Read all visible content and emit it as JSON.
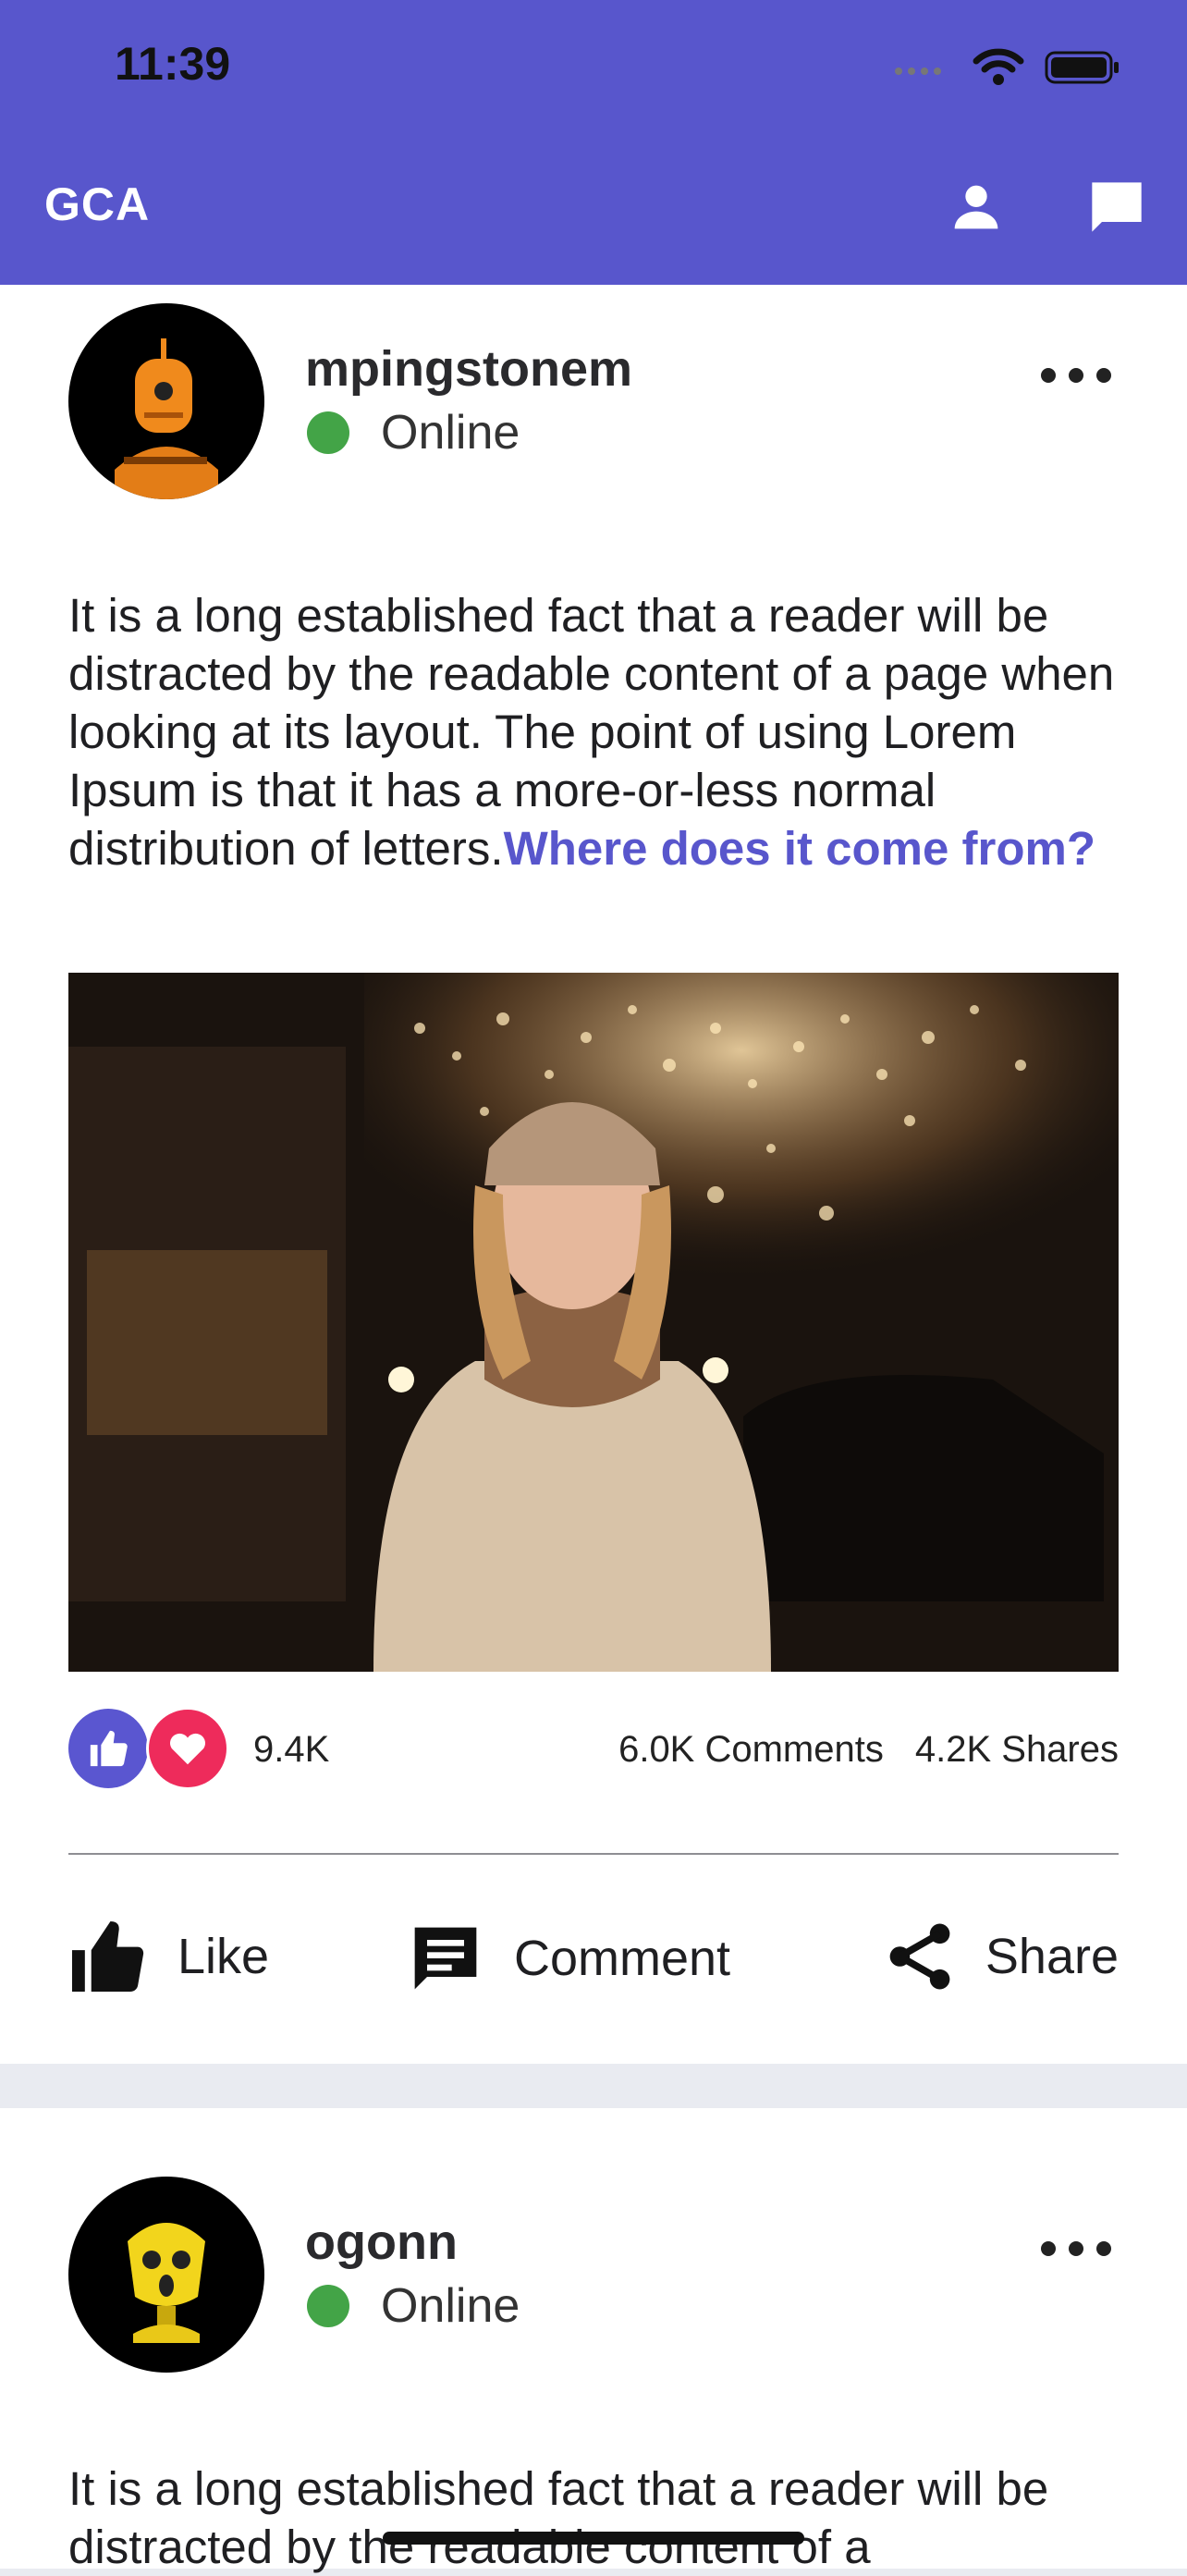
{
  "status_bar": {
    "time": "11:39"
  },
  "app_bar": {
    "title": "GCA",
    "icons": [
      "profile-icon",
      "chat-icon"
    ],
    "color": "#5856cc"
  },
  "posts": [
    {
      "username": "mpingstonem",
      "presence": "Online",
      "caption": "It is a long established fact that a reader will be distracted by the readable content of a page when looking at its layout. The point of using Lorem Ipsum is that it has a more-or-less normal distribution of letters.",
      "link": "Where does it come from?",
      "likes": "9.4K",
      "comments": "6.0K Comments",
      "shares": "4.2K Shares"
    },
    {
      "username": "ogonn",
      "presence": "Online",
      "caption": "It is a long established fact that a reader will be distracted by the readable content of a"
    }
  ],
  "actions": {
    "like": "Like",
    "comment": "Comment",
    "share": "Share"
  },
  "colors": {
    "accent": "#5856cc",
    "online": "#43a447",
    "love": "#ee2b5b"
  }
}
